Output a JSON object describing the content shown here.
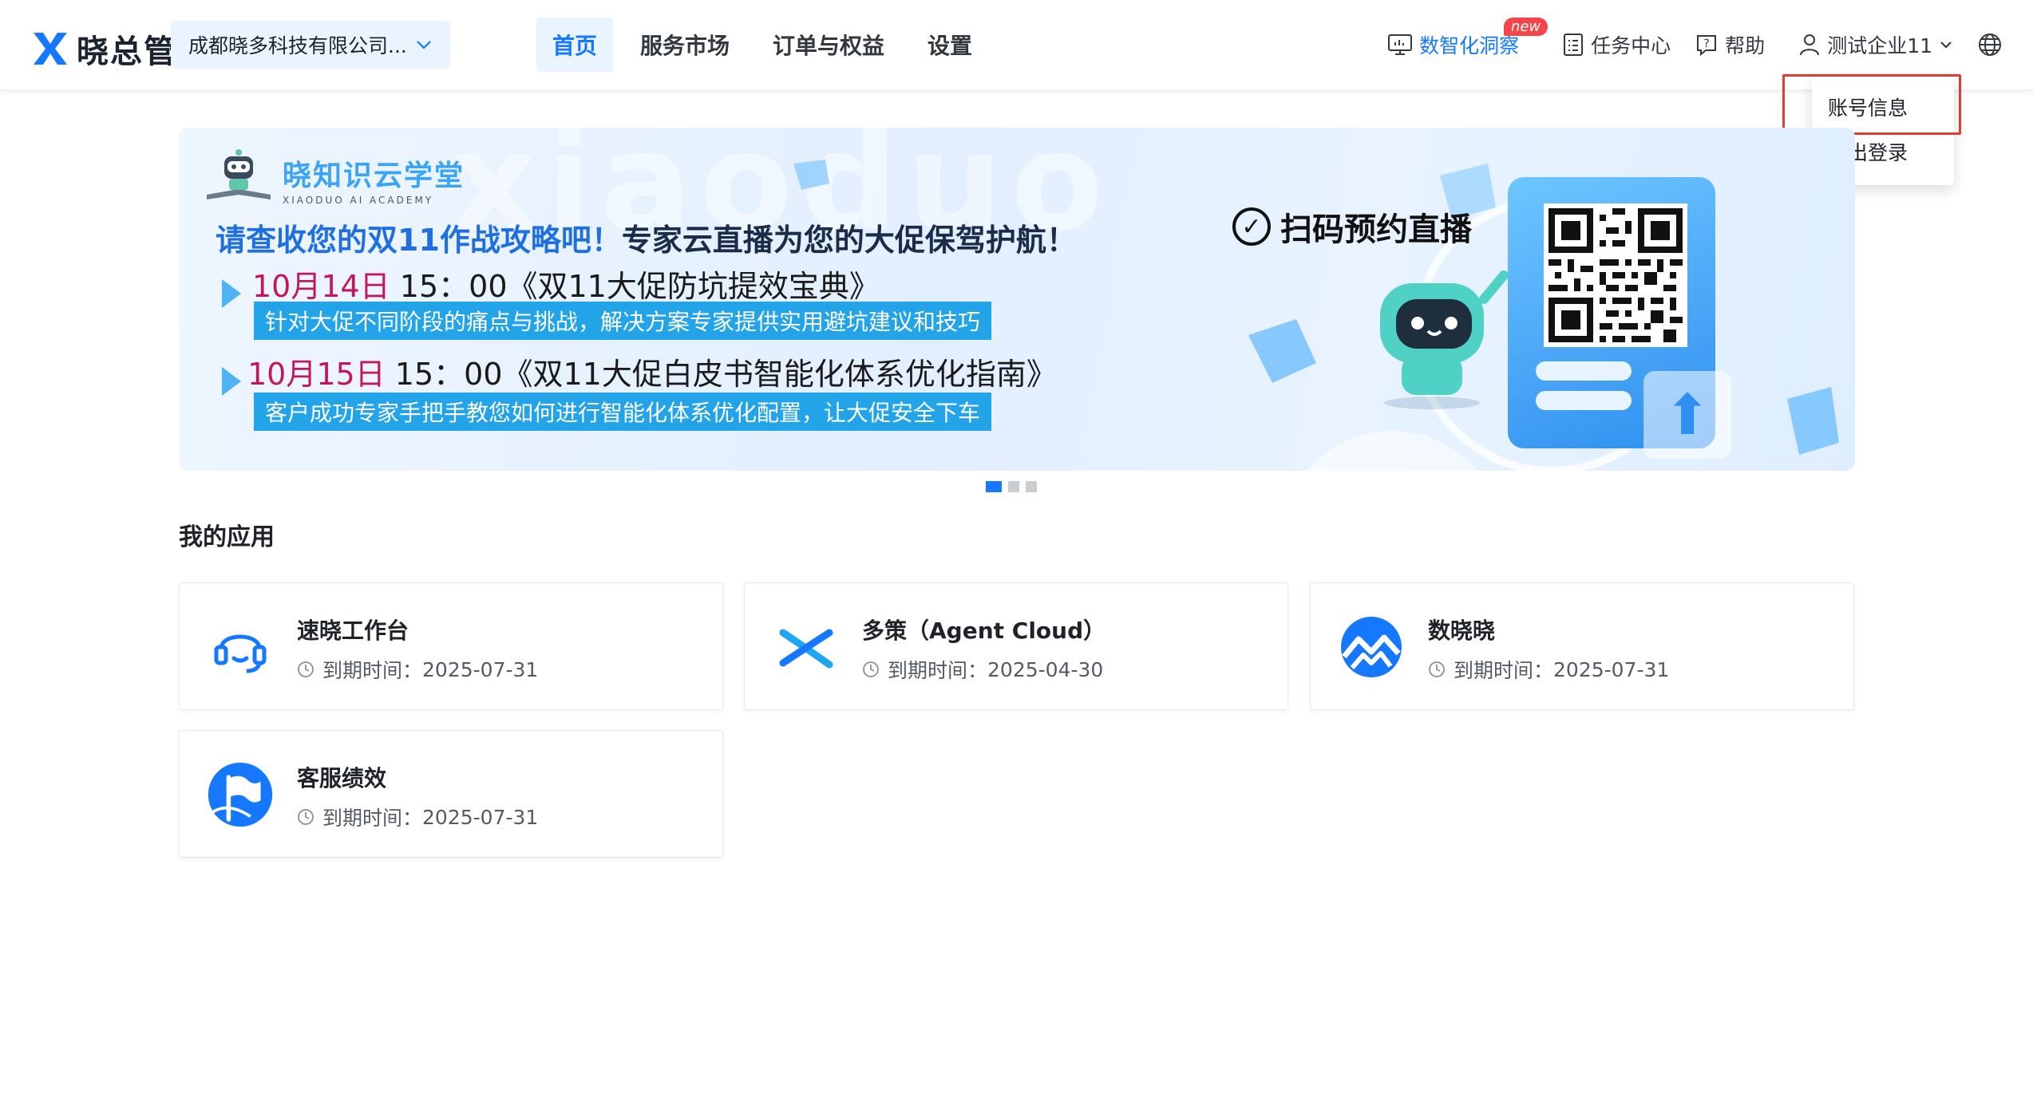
{
  "header": {
    "brand": "晓总管",
    "org_select": "成都晓多科技有限公司...",
    "nav": [
      {
        "label": "首页",
        "active": true
      },
      {
        "label": "服务市场",
        "active": false
      },
      {
        "label": "订单与权益",
        "active": false
      },
      {
        "label": "设置",
        "active": false
      }
    ],
    "tools": {
      "insight": "数智化洞察",
      "new_badge": "new",
      "tasks": "任务中心",
      "help": "帮助",
      "user": "测试企业11"
    }
  },
  "user_menu": {
    "items": [
      "账号信息",
      "退出登录"
    ],
    "highlighted": "账号信息"
  },
  "banner": {
    "watermark": "xiaoduo",
    "academy_name": "晓知识云学堂",
    "academy_en": "XIAODUO AI ACADEMY",
    "headline_blue": "请查收您的双11作战攻略吧！",
    "headline_dark": "专家云直播为您的大促保驾护航！",
    "session1_date": "10月14日",
    "session1_title": " 15：00《双11大促防坑提效宝典》",
    "session1_desc": "针对大促不同阶段的痛点与挑战，解决方案专家提供实用避坑建议和技巧",
    "session2_date": "10月15日",
    "session2_title": " 15：00《双11大促白皮书智能化体系优化指南》",
    "session2_desc": "客户成功专家手把手教您如何进行智能化体系优化配置，让大促安全下车",
    "scan_cta": "扫码预约直播",
    "carousel_pages": 3,
    "carousel_active": 1
  },
  "apps": {
    "title": "我的应用",
    "expire_label": "到期时间：",
    "items": [
      {
        "name": "速晓工作台",
        "expire": "2025-07-31",
        "icon": "headset-icon"
      },
      {
        "name": "多策（Agent Cloud）",
        "expire": "2025-04-30",
        "icon": "agent-cloud-icon"
      },
      {
        "name": "数晓晓",
        "expire": "2025-07-31",
        "icon": "data-chart-icon"
      },
      {
        "name": "客服绩效",
        "expire": "2025-07-31",
        "icon": "flag-icon"
      }
    ]
  },
  "colors": {
    "primary": "#1677ff",
    "highlight_box": "#e23b35",
    "badge": "#f5454b"
  }
}
